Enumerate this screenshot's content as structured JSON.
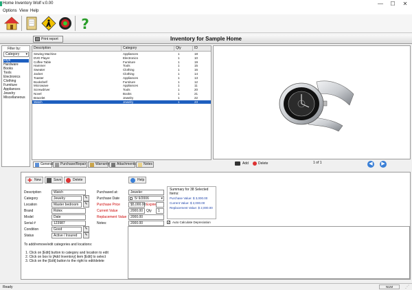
{
  "window": {
    "title": "Home Inventory Wolf v.0.00",
    "minimize": "—",
    "maximize": "☐",
    "close": "✕"
  },
  "menu": [
    "Options",
    "View",
    "Help"
  ],
  "toolbar": {
    "buttons": [
      {
        "name": "home-icon",
        "color": "#d33"
      },
      {
        "name": "notebook-icon",
        "color": "#c9a44a"
      },
      {
        "name": "caution-sign-icon",
        "color": "#f2c200"
      },
      {
        "name": "target-icon",
        "color": "#c22"
      },
      {
        "name": "help-icon",
        "color": "#2a9d2a"
      }
    ]
  },
  "header": {
    "title": "Inventory for Sample Home",
    "print_button": "Print report"
  },
  "filter": {
    "label": "Filter by:",
    "select": "Category",
    "items": [
      "Toys",
      "Hardware",
      "Books",
      "Tools",
      "Electronics",
      "Clothing",
      "Furniture",
      "Appliances",
      "Jewelry",
      "Miscellaneous"
    ],
    "selected_index": 0
  },
  "grid": {
    "columns": [
      "Description",
      "Category",
      "Qty",
      "ID"
    ],
    "rows": [
      [
        "Sewing Machine",
        "Appliances",
        "1",
        "18"
      ],
      [
        "DVD Player",
        "Electronics",
        "1",
        "10"
      ],
      [
        "Coffee Table",
        "Furniture",
        "1",
        "19"
      ],
      [
        "Hammer",
        "Tools",
        "1",
        "15"
      ],
      [
        "Sweater",
        "Clothing",
        "1",
        "16"
      ],
      [
        "Jacket",
        "Clothing",
        "1",
        "14"
      ],
      [
        "Toaster",
        "Appliances",
        "1",
        "13"
      ],
      [
        "Bookshelf",
        "Furniture",
        "1",
        "12"
      ],
      [
        "Microwave",
        "Appliances",
        "1",
        "11"
      ],
      [
        "Screwdriver",
        "Tools",
        "1",
        "20"
      ],
      [
        "Novel",
        "Books",
        "1",
        "21"
      ],
      [
        "Bracelet",
        "Jewelry",
        "1",
        "22"
      ],
      [
        "Watch",
        "Jewelry",
        "1",
        "23"
      ]
    ],
    "selected_index": 12
  },
  "tabs": [
    "General",
    "Purchase/Repair",
    "Warranty",
    "Attachments",
    "Notes"
  ],
  "image": {
    "counter": "1 of 1",
    "add": "Add",
    "delete": "Delete",
    "watch_colors": {
      "steel": "#c9ccd0",
      "dark": "#2b2b2b",
      "bezel": "#111"
    }
  },
  "form": {
    "buttons": {
      "new": "New",
      "save": "Save",
      "delete": "Delete",
      "help": "Help"
    },
    "labels": {
      "description": "Description",
      "category": "Category",
      "location": "Location",
      "brand": "Brand",
      "model": "Model",
      "serial": "Serial #",
      "condition": "Condition",
      "status": "Status",
      "purchased_at": "Purchased at:",
      "purchase_date": "Purchase Date",
      "purchase_price": "Purchase Price",
      "current_value": "Current Value",
      "replacement_value": "Replacement Value",
      "notes": "Notes:",
      "expire": "Expire",
      "qty": "Qty"
    },
    "values": {
      "description": "Watch",
      "category": "Jewelry",
      "location": "Master bedroom",
      "brand": "Rolex",
      "model": "Date",
      "serial": "123987",
      "condition": "Good",
      "status": "Active / Insured",
      "purchased_at": "Jeweler",
      "purchase_date": "5/ 9/2006",
      "purchase_price": "$5,000.00",
      "expire": "",
      "qty": "1",
      "current_value": "2000.00",
      "replacement_value": "2000.00"
    },
    "summary": {
      "title": "Summary for 38 Selected Items:",
      "purchase": "Purchase Value: $ 3,000.00",
      "current": "Current Value: $ 2,000.00",
      "replacement": "Replacement Value: $ 2,000.00",
      "checkbox": "Auto Calculate Depreciation"
    },
    "hints": [
      "To add/remove/edit categories and locations:",
      "1. Click on [Edit] button to category and location to edit",
      "2. Click on box to [Add Inventory] item [Edit] to select",
      "3. Click on the [Edit] button to the right to edit/delete"
    ]
  },
  "status": {
    "left": "Ready",
    "right": "NUM"
  }
}
